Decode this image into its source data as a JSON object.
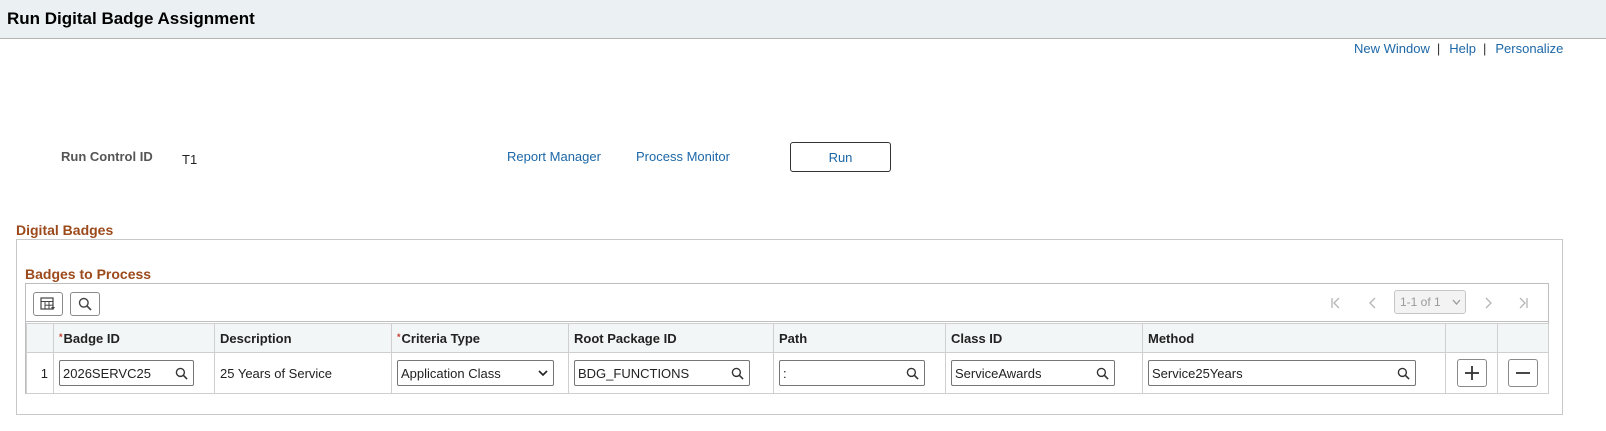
{
  "page": {
    "title": "Run Digital Badge Assignment"
  },
  "header_links": {
    "new_window": "New Window",
    "help": "Help",
    "personalize": "Personalize",
    "separator": "|"
  },
  "run_control": {
    "label": "Run Control ID",
    "value": "T1",
    "report_manager": "Report Manager",
    "process_monitor": "Process Monitor",
    "run_button": "Run"
  },
  "sections": {
    "digital_badges": "Digital Badges",
    "badges_to_process": "Badges to Process"
  },
  "grid": {
    "toolbar_icons": [
      "personalize-grid-icon",
      "find-icon"
    ],
    "nav_icons": [
      "first-page-icon",
      "previous-page-icon",
      "next-page-icon",
      "last-page-icon"
    ],
    "pager": "1-1 of 1",
    "columns": {
      "badge_id": "Badge ID",
      "description": "Description",
      "criteria_type": "Criteria Type",
      "root_package_id": "Root Package ID",
      "path": "Path",
      "class_id": "Class ID",
      "method": "Method"
    },
    "required_marker": "*",
    "rows": [
      {
        "num": "1",
        "badge_id": "2026SERVC25",
        "description": "25 Years of Service",
        "criteria_type": "Application Class",
        "root_package_id": "BDG_FUNCTIONS",
        "path": ":",
        "class_id": "ServiceAwards",
        "method": "Service25Years"
      }
    ]
  },
  "colors": {
    "link": "#1c67a7",
    "section_title": "#9c4a1c",
    "title_bar": "#ebf1f2",
    "required": "#c0392b"
  }
}
